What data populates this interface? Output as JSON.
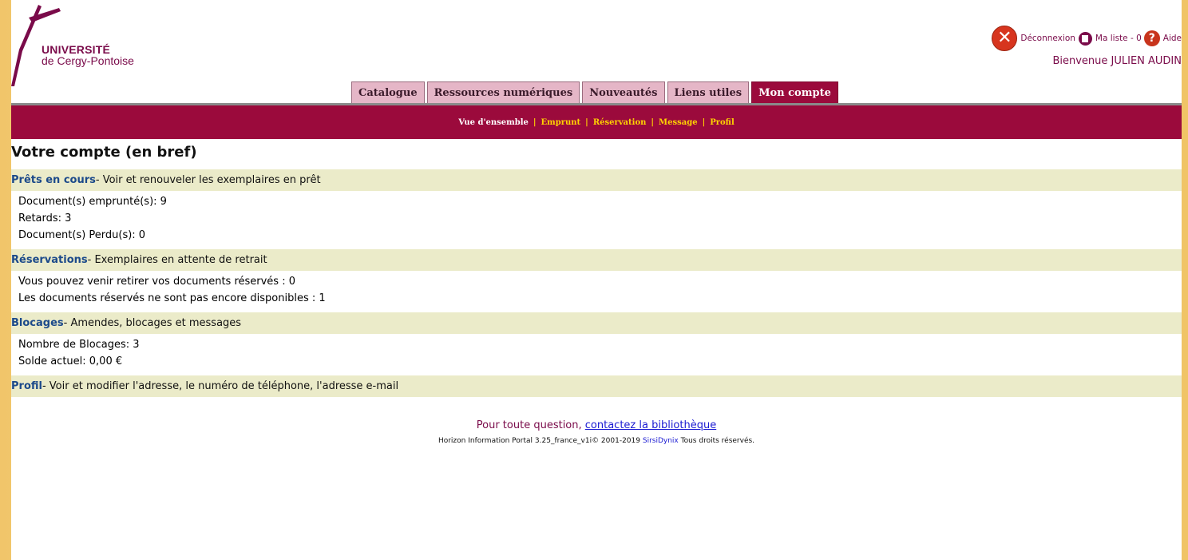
{
  "logo": {
    "line1": "UNIVERSITÉ",
    "line2": "de Cergy-Pontoise"
  },
  "toplinks": {
    "logout": "Déconnexion",
    "my_list": "Ma liste - 0",
    "help": "Aide",
    "help_glyph": "?",
    "logout_glyph": "✕"
  },
  "welcome": "Bienvenue JULIEN AUDIN",
  "tabs": [
    {
      "label": "Catalogue"
    },
    {
      "label": "Ressources numériques"
    },
    {
      "label": "Nouveautés"
    },
    {
      "label": "Liens utiles"
    },
    {
      "label": "Mon compte"
    }
  ],
  "subnav": {
    "items": [
      "Vue d'ensemble",
      "Emprunt",
      "Réservation",
      "Message",
      "Profil"
    ],
    "separator": "|"
  },
  "page_title": "Votre compte (en bref)",
  "sections": [
    {
      "title": "Prêts en cours",
      "desc": "- Voir et renouveler les exemplaires en prêt",
      "lines": [
        "Document(s) emprunté(s): 9",
        "Retards: 3",
        "Document(s) Perdu(s): 0"
      ]
    },
    {
      "title": "Réservations",
      "desc": "- Exemplaires en attente de retrait",
      "lines": [
        "Vous pouvez venir retirer vos documents réservés : 0",
        "Les documents réservés ne sont pas encore disponibles : 1"
      ]
    },
    {
      "title": "Blocages",
      "desc": "- Amendes, blocages et messages",
      "lines": [
        "Nombre de Blocages: 3",
        "Solde actuel: 0,00 €"
      ]
    },
    {
      "title": "Profil",
      "desc": "- Voir et modifier l'adresse, le numéro de téléphone, l'adresse e-mail",
      "lines": []
    }
  ],
  "footer": {
    "question_prefix": "Pour toute question,",
    "contact_link": "contactez la bibliothèque",
    "copyright_prefix": "Horizon Information Portal 3.25_france_v1i© 2001-2019",
    "vendor_link": "SirsiDynix",
    "copyright_suffix": "Tous droits réservés."
  },
  "colors": {
    "brand": "#9b0a3c",
    "subnav_link": "#ffd400",
    "section_bg": "#ebebc9",
    "section_title": "#1c4a8a"
  }
}
